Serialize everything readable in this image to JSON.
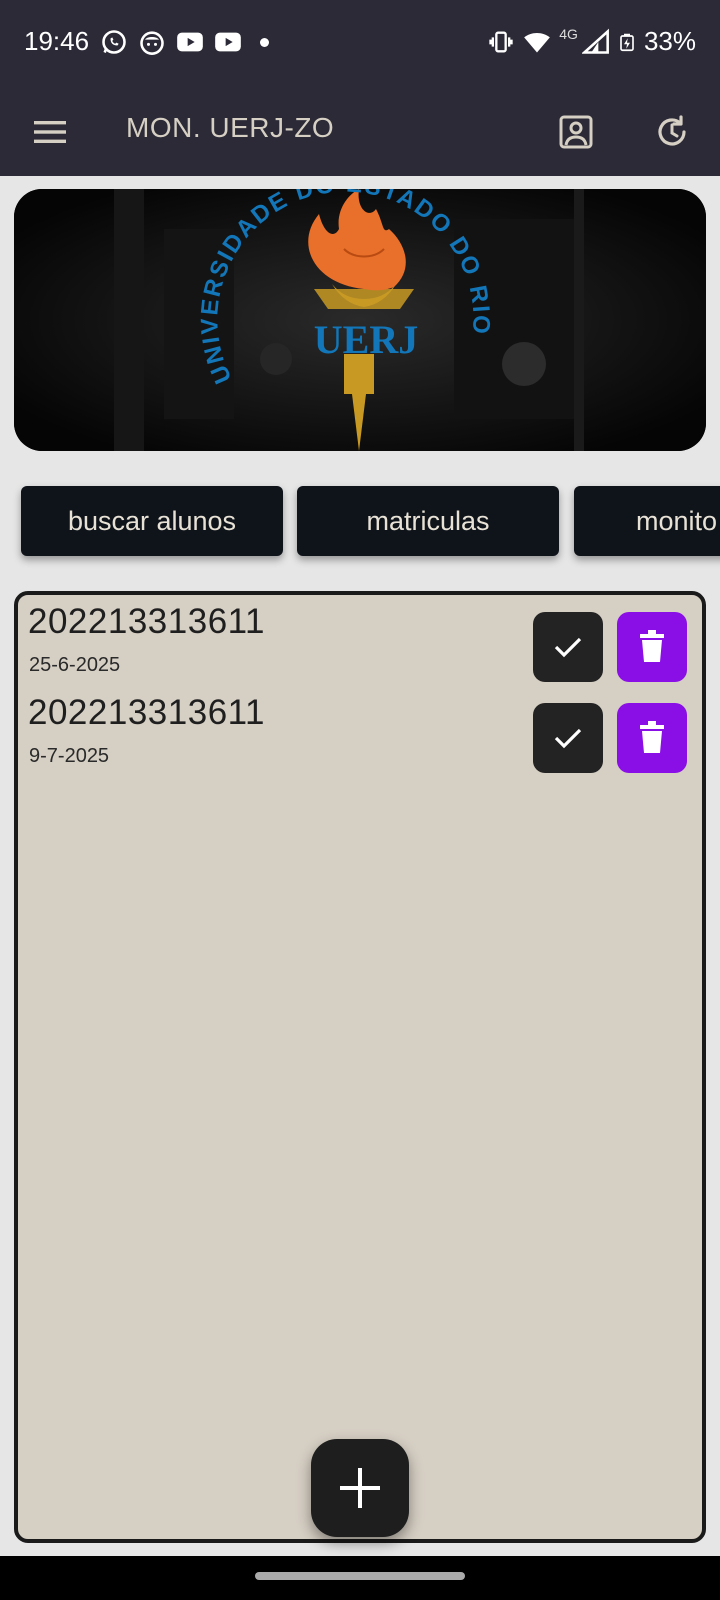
{
  "status_bar": {
    "time": "19:46",
    "left_icons": [
      "whatsapp-icon",
      "face-icon",
      "youtube-icon",
      "youtube-icon",
      "dot-icon"
    ],
    "network_label": "4G",
    "battery": "33%"
  },
  "app_bar": {
    "title": "MON. UERJ-ZO",
    "icons": [
      "menu-icon",
      "profile-icon",
      "refresh-icon"
    ]
  },
  "banner": {
    "logo_top_text": "UNIVERSIDADE",
    "logo_mid_text": "UERJ",
    "logo_bottom_text": "DO ESTADO DO RIO DE JANEIRO"
  },
  "tabs": [
    {
      "label": "buscar alunos"
    },
    {
      "label": "matriculas"
    },
    {
      "label": "monito"
    }
  ],
  "items": [
    {
      "id": "202213313611",
      "date": "25-6-2025"
    },
    {
      "id": "202213313611",
      "date": "9-7-2025"
    }
  ],
  "colors": {
    "app_bar": "#2b2a36",
    "panel": "#d6cfc4",
    "delete": "#8a0fe6",
    "check": "#232323",
    "tab": "#0f141b",
    "logo_blue": "#1276b8",
    "flame_orange": "#e8702a"
  }
}
